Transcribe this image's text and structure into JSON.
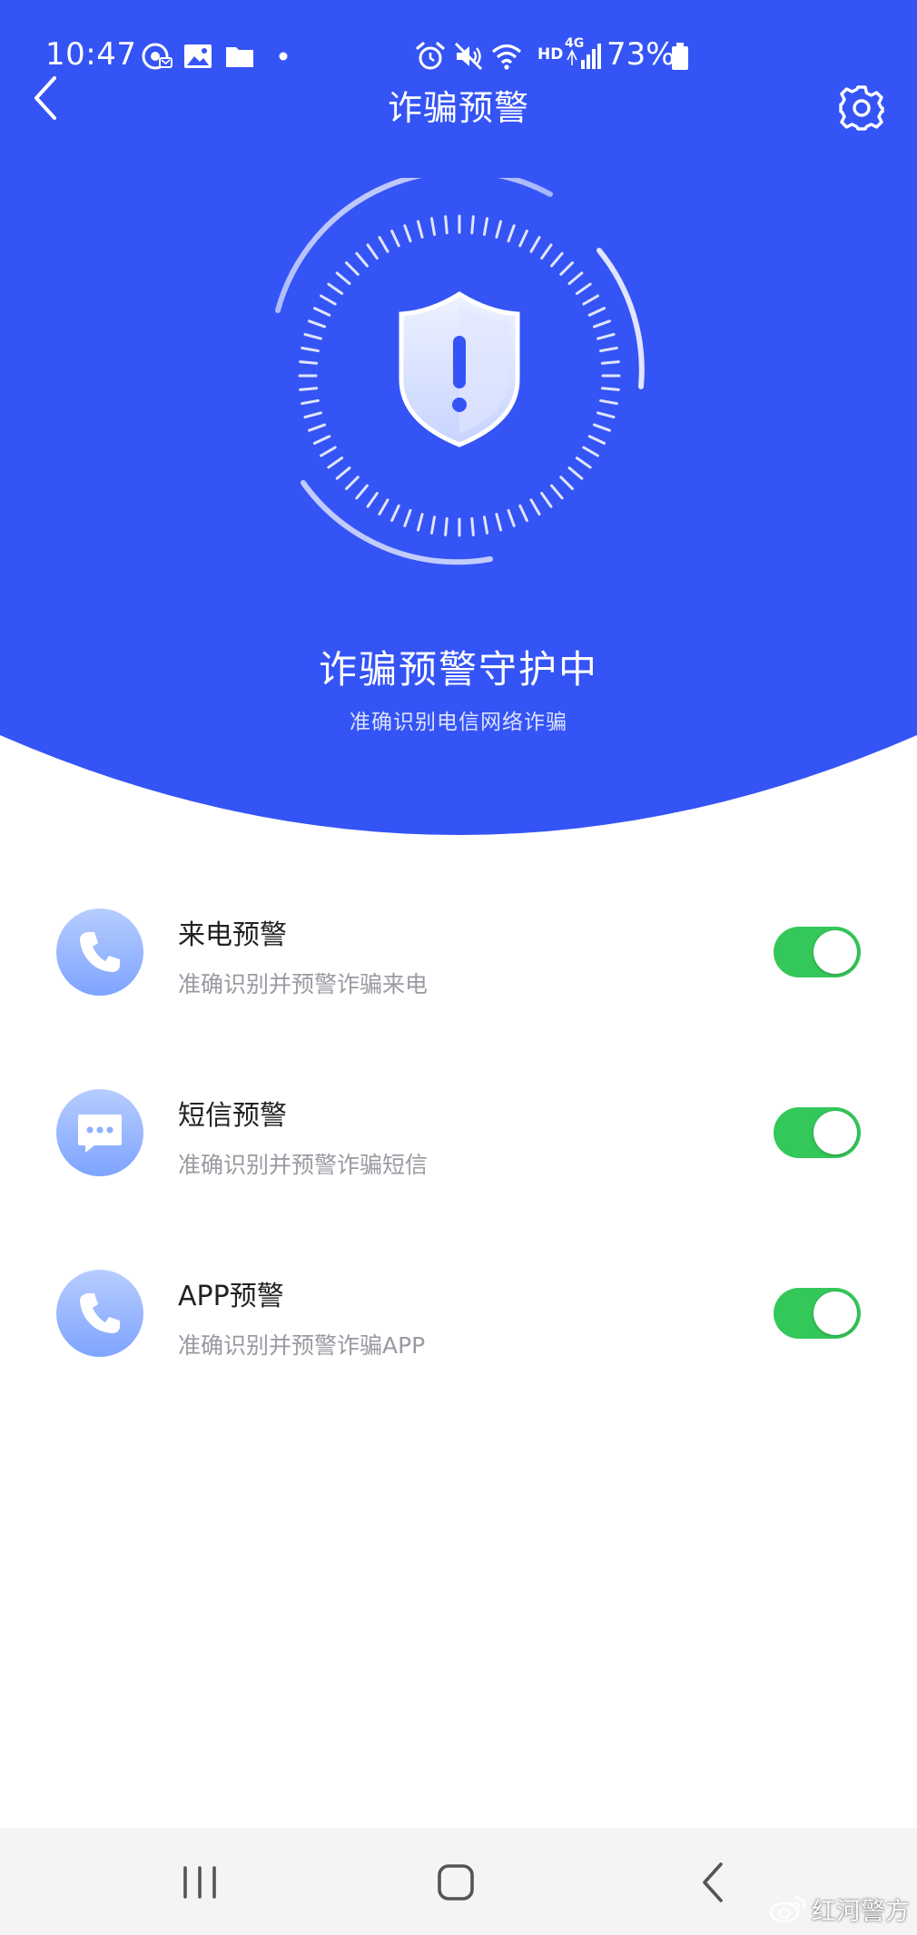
{
  "status_bar": {
    "time": "10:47",
    "hd": "HD",
    "network": "4G",
    "battery_percent": "73%",
    "icons": [
      "chrome-icon",
      "gallery-icon",
      "folder-icon",
      "notification-dot",
      "alarm-icon",
      "mute-icon",
      "wifi-icon",
      "signal-icon",
      "battery-icon"
    ]
  },
  "header": {
    "title": "诈骗预警",
    "back_icon": "chevron-left-icon",
    "settings_icon": "gear-icon"
  },
  "hero": {
    "title": "诈骗预警守护中",
    "subtitle": "准确识别电信网络诈骗",
    "shield_icon": "shield-alert-icon"
  },
  "features": [
    {
      "title": "来电预警",
      "desc": "准确识别并预警诈骗来电",
      "icon": "phone-icon",
      "enabled": true
    },
    {
      "title": "短信预警",
      "desc": "准确识别并预警诈骗短信",
      "icon": "message-icon",
      "enabled": true
    },
    {
      "title": "APP预警",
      "desc": "准确识别并预警诈骗APP",
      "icon": "phone-icon",
      "enabled": true
    }
  ],
  "nav_bar": {
    "buttons": [
      "recent-apps-icon",
      "home-icon",
      "back-icon"
    ]
  },
  "watermark": {
    "text": "红河警方",
    "icon": "weibo-icon"
  },
  "colors": {
    "primary_blue": "#3554f5",
    "toggle_on": "#34c759",
    "icon_circle": "#8fb0ff"
  }
}
